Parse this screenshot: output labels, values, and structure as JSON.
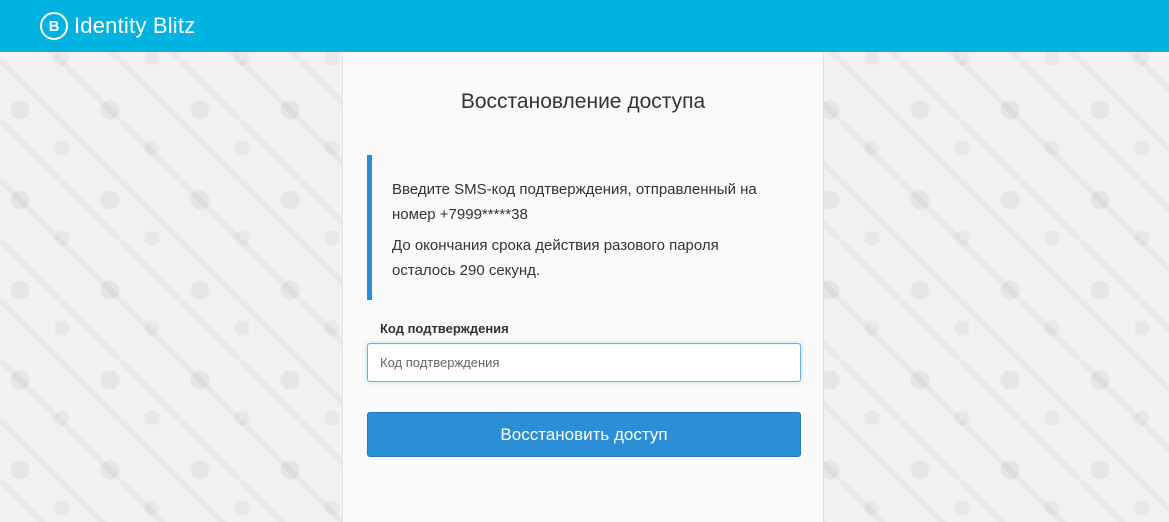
{
  "header": {
    "logo_mark": "B",
    "brand": "Identity Blitz",
    "background_color": "#00b2e0"
  },
  "recovery": {
    "title": "Восстановление доступа",
    "notice_line1": "Введите SMS-код подтверждения, отправленный на номер +7999*****38",
    "notice_line2": "До окончания срока действия разового пароля осталось 290 секунд.",
    "code_label": "Код подтверждения",
    "code_placeholder": "Код подтверждения",
    "code_value": "",
    "submit_label": "Восстановить доступ",
    "accent_color": "#2b8fd6"
  }
}
